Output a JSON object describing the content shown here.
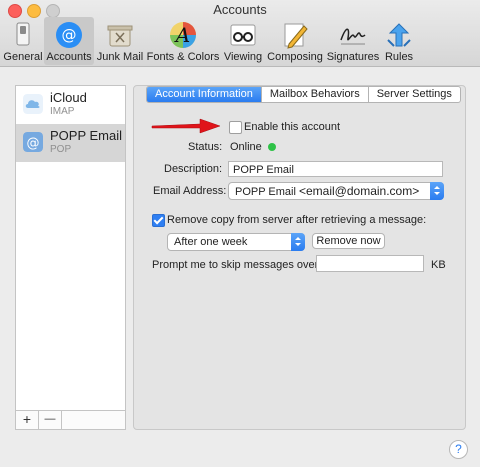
{
  "window": {
    "title": "Accounts"
  },
  "toolbar": {
    "items": [
      {
        "label": "General",
        "icon": "switch-icon"
      },
      {
        "label": "Accounts",
        "icon": "at-sign-icon"
      },
      {
        "label": "Junk Mail",
        "icon": "trash-icon"
      },
      {
        "label": "Fonts & Colors",
        "icon": "font-palette-icon"
      },
      {
        "label": "Viewing",
        "icon": "glasses-icon"
      },
      {
        "label": "Composing",
        "icon": "pencil-icon"
      },
      {
        "label": "Signatures",
        "icon": "signature-icon"
      },
      {
        "label": "Rules",
        "icon": "rules-icon"
      }
    ],
    "active": "Accounts"
  },
  "sidebar": {
    "accounts": [
      {
        "name": "iCloud",
        "type": "IMAP",
        "icon": "cloud-icon"
      },
      {
        "name": "POPP Email",
        "type": "POP",
        "icon": "at-sign-icon"
      }
    ],
    "selected": "POPP Email",
    "add_label": "+",
    "remove_label": "—"
  },
  "tabs": [
    {
      "label": "Account Information"
    },
    {
      "label": "Mailbox Behaviors"
    },
    {
      "label": "Server Settings"
    }
  ],
  "active_tab": "Account Information",
  "form": {
    "enable_label": "Enable this account",
    "enable_checked": false,
    "status_label": "Status:",
    "status_value": "Online",
    "status_color": "#2ec247",
    "description_label": "Description:",
    "description_value": "POPP Email",
    "email_label": "Email Address:",
    "email_name": "POPP Email",
    "email_value": "<email@domain.com>",
    "remove_copy_label": "Remove copy from server after retrieving a message:",
    "remove_copy_checked": true,
    "remove_period": "After one week",
    "remove_now_label": "Remove now",
    "prompt_label": "Prompt me to skip messages over",
    "prompt_value": "",
    "prompt_unit": "KB"
  },
  "help_label": "?",
  "colors": {
    "accent": "#2a7cf0",
    "annotation_arrow": "#e0141a"
  }
}
